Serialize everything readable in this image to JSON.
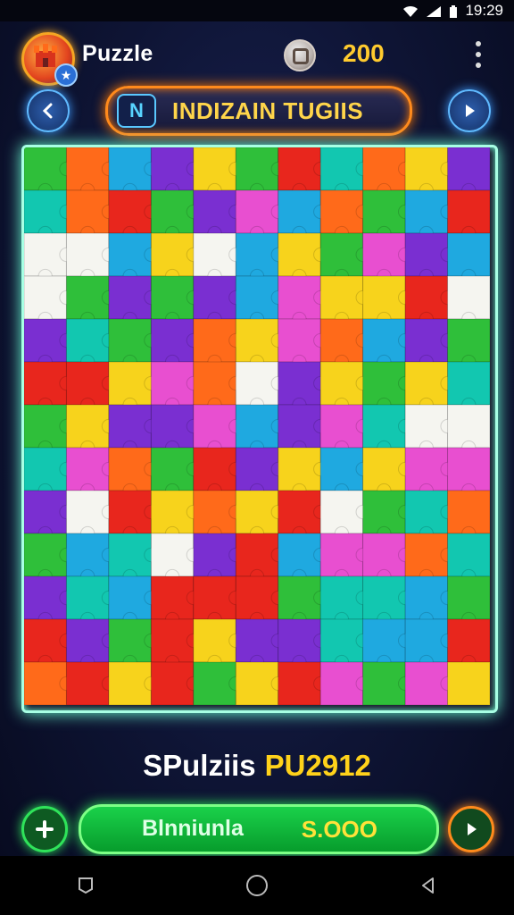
{
  "status_bar": {
    "time": "19:29",
    "icons": [
      "wifi-icon",
      "signal-icon",
      "battery-icon"
    ]
  },
  "header": {
    "title": "Puzzle",
    "coins": "200",
    "logo_icon": "castle-icon",
    "coin_icon": "coin-icon",
    "menu_icon": "more-vert-icon"
  },
  "level": {
    "badge": "N",
    "title": "INDIZAIN TUGIIS",
    "prev_icon": "chevron-left-icon",
    "next_icon": "play-icon"
  },
  "board": {
    "rows": 13,
    "cols": 11,
    "palette": [
      "#e8261d",
      "#1fa9e0",
      "#7a2fd1",
      "#f7d31c",
      "#2fbf3a",
      "#ff6a1a",
      "#e84fd0",
      "#12c7b0",
      "#f5f5f0"
    ]
  },
  "caption": {
    "name": "SPulziis",
    "code": "PU2912"
  },
  "footer": {
    "label": "Blnniunla",
    "value": "S.OOO",
    "add_icon": "plus-icon",
    "play_icon": "play-icon"
  },
  "colors": {
    "accent_orange": "#ff8a1c",
    "accent_green": "#2fe35a",
    "accent_yellow": "#ffd21a",
    "board_glow": "#a8ffe4"
  },
  "nav": [
    "back-icon",
    "home-icon",
    "recents-icon"
  ]
}
